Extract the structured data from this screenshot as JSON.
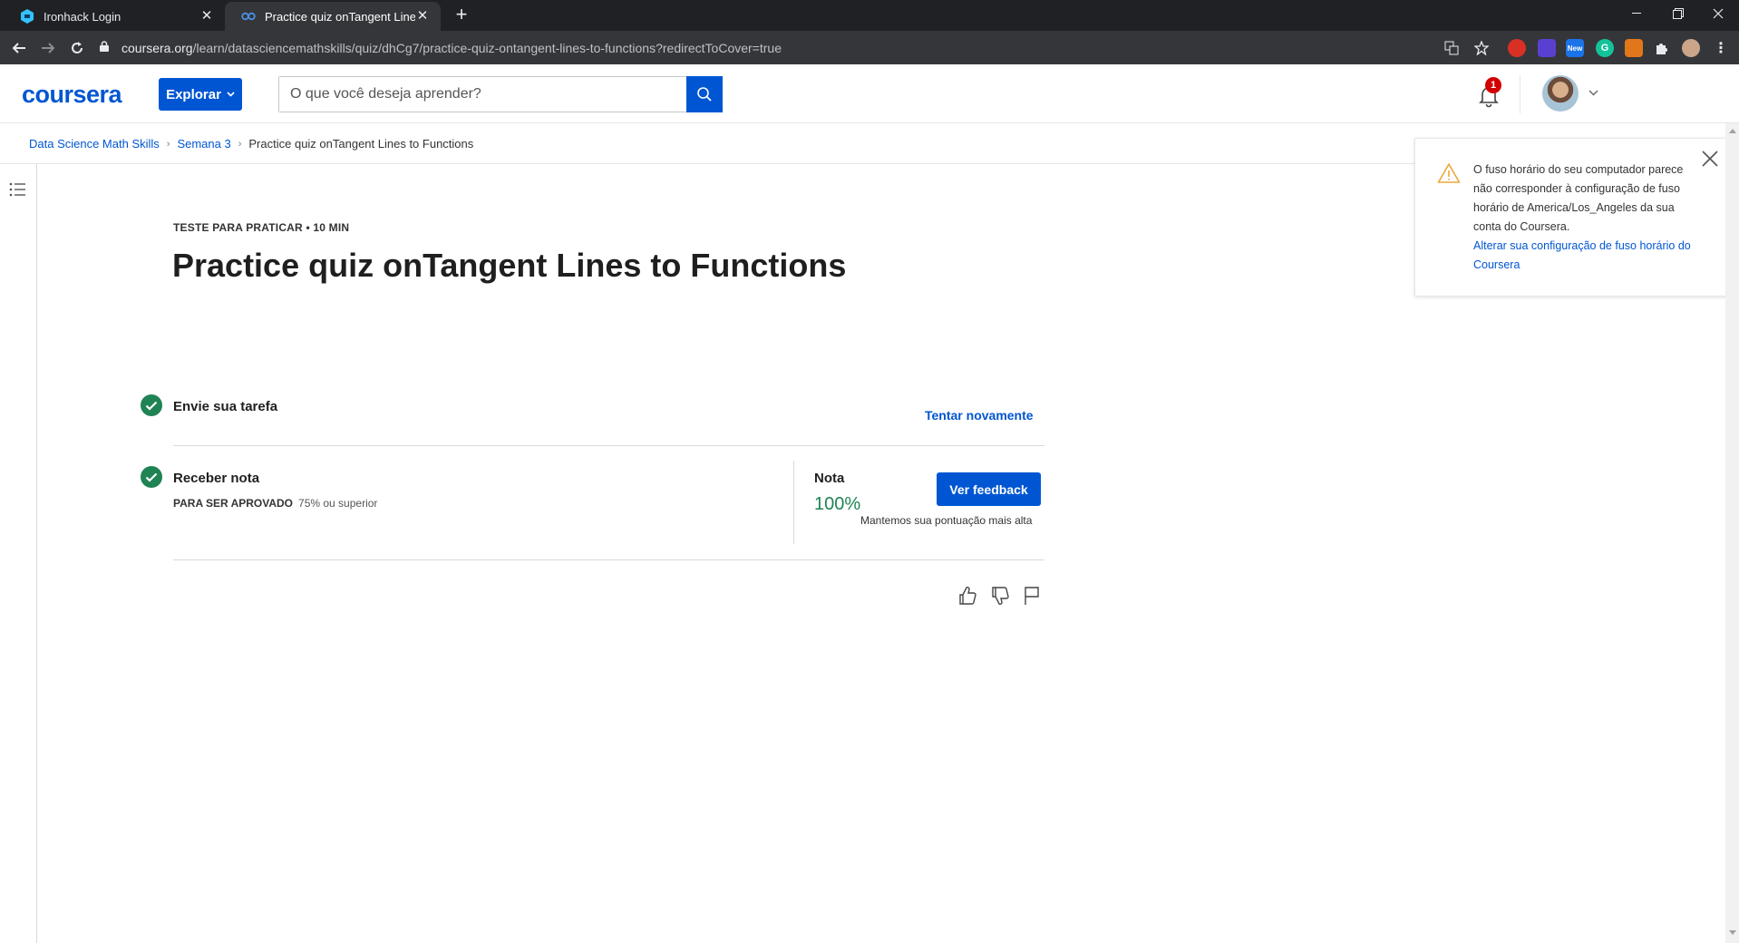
{
  "browser": {
    "tabs": [
      {
        "title": "Ironhack Login",
        "active": false
      },
      {
        "title": "Practice quiz onTangent Lines to",
        "active": true
      }
    ],
    "new_tab": "+",
    "url_domain": "coursera.org",
    "url_path": "/learn/datasciencemathskills/quiz/dhCg7/practice-quiz-ontangent-lines-to-functions?redirectToCover=true",
    "extension_new_badge": "New"
  },
  "header": {
    "logo": "coursera",
    "explore_label": "Explorar",
    "search_placeholder": "O que você deseja aprender?",
    "notification_count": "1"
  },
  "breadcrumb": {
    "items": [
      "Data Science Math Skills",
      "Semana 3"
    ],
    "current": "Practice quiz onTangent Lines to Functions"
  },
  "quiz": {
    "eyebrow": "TESTE PARA PRATICAR • 10 MIN",
    "title": "Practice quiz onTangent Lines to Functions",
    "step1_label": "Envie sua tarefa",
    "retry_label": "Tentar novamente",
    "step2_label": "Receber nota",
    "pass_label": "PARA SER APROVADO",
    "pass_value": "75% ou superior",
    "grade_label": "Nota",
    "grade_value": "100%",
    "feedback_label": "Ver feedback",
    "keep_note": "Mantemos sua pontuação mais alta"
  },
  "toast": {
    "message": "O fuso horário do seu computador parece não corresponder à configuração de fuso horário de America/Los_Angeles da sua conta do Coursera.",
    "link": "Alterar sua configuração de fuso horário do Coursera"
  },
  "colors": {
    "brand": "#0056d2",
    "success": "#1f8354",
    "badge": "#d30001"
  }
}
